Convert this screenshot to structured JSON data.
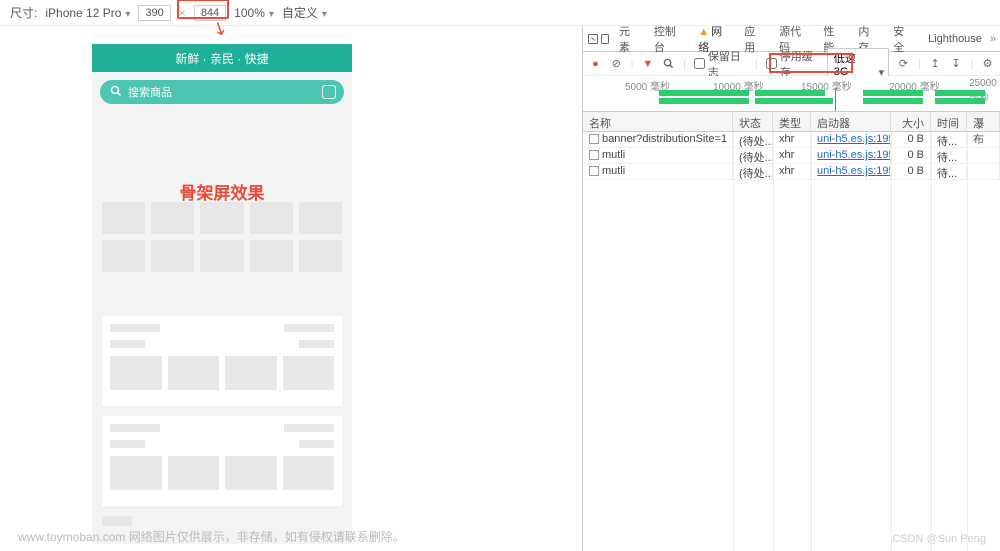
{
  "device_bar": {
    "label": "尺寸:",
    "device": "iPhone 12 Pro",
    "width": "390",
    "height": "844",
    "zoom": "100%",
    "custom": "自定义"
  },
  "preview": {
    "header_slogan": "新鲜 · 亲民 · 快捷",
    "search_placeholder": "搜索商品",
    "skeleton_label": "骨架屏效果"
  },
  "devtools": {
    "tabs": [
      "元素",
      "控制台",
      "网络",
      "应用",
      "源代码",
      "性能",
      "内存",
      "安全",
      "Lighthouse"
    ],
    "active_tab_index": 2,
    "toolbar": {
      "preserve_log": "保留日志",
      "disable_cache": "停用缓存",
      "throttle": "低速 3G"
    },
    "timeline_ticks": [
      "5000 毫秒",
      "10000 毫秒",
      "15000 毫秒",
      "20000 毫秒",
      "25000 毫秒"
    ],
    "columns": {
      "name": "名称",
      "status": "状态",
      "type": "类型",
      "initiator": "启动器",
      "size": "大小",
      "time": "时间",
      "waterfall": "瀑布"
    },
    "requests": [
      {
        "name": "banner?distributionSite=1",
        "status": "(待处...",
        "type": "xhr",
        "initiator": "uni-h5.es.js:195...",
        "size": "0 B",
        "time": "待..."
      },
      {
        "name": "mutli",
        "status": "(待处...",
        "type": "xhr",
        "initiator": "uni-h5.es.js:195...",
        "size": "0 B",
        "time": "待..."
      },
      {
        "name": "mutli",
        "status": "(待处...",
        "type": "xhr",
        "initiator": "uni-h5.es.js:195...",
        "size": "0 B",
        "time": "待..."
      }
    ]
  },
  "footer": {
    "site": "www.toymoban.com",
    "disclaimer": "网络图片仅供展示，非存储，如有侵权请联系删除。",
    "attribution": "CSDN @Sun Peng"
  }
}
